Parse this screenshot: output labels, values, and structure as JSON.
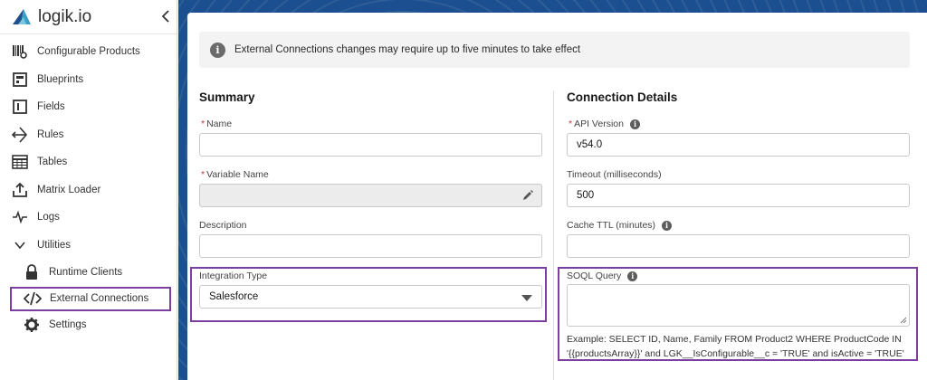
{
  "brand": {
    "name": "logik.io"
  },
  "sidebar": {
    "items": [
      {
        "label": "Configurable Products",
        "icon": "configurable-products-icon"
      },
      {
        "label": "Blueprints",
        "icon": "blueprint-icon"
      },
      {
        "label": "Fields",
        "icon": "field-icon"
      },
      {
        "label": "Rules",
        "icon": "rules-icon"
      },
      {
        "label": "Tables",
        "icon": "table-icon"
      },
      {
        "label": "Matrix Loader",
        "icon": "upload-icon"
      },
      {
        "label": "Logs",
        "icon": "pulse-icon"
      },
      {
        "label": "Utilities",
        "icon": "chevron-down-icon"
      },
      {
        "label": "Runtime Clients",
        "icon": "lock-icon"
      },
      {
        "label": "External Connections",
        "icon": "code-icon"
      },
      {
        "label": "Settings",
        "icon": "gear-icon"
      }
    ]
  },
  "alert": {
    "text": "External Connections changes may require up to five minutes to take effect"
  },
  "summary": {
    "title": "Summary",
    "name_label": "Name",
    "name_value": "",
    "variable_label": "Variable Name",
    "variable_value": "",
    "description_label": "Description",
    "description_value": "",
    "integration_label": "Integration Type",
    "integration_value": "Salesforce"
  },
  "details": {
    "title": "Connection Details",
    "api_label": "API Version",
    "api_value": "v54.0",
    "timeout_label": "Timeout (milliseconds)",
    "timeout_value": "500",
    "cache_label": "Cache TTL (minutes)",
    "cache_value": "",
    "soql_label": "SOQL Query",
    "soql_value": "",
    "example_line1": "Example: SELECT ID, Name, Family FROM Product2 WHERE ProductCode IN",
    "example_line2": "'{{productsArray}}' and LGK__IsConfigurable__c = 'TRUE' and isActive = 'TRUE'"
  },
  "colors": {
    "accent": "#7b3fa0",
    "banner": "#1c4f8f",
    "required": "#c23934"
  }
}
